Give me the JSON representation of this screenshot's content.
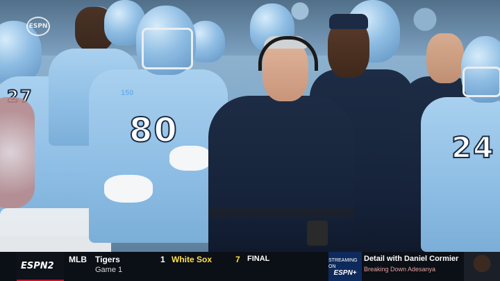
{
  "broadcast": {
    "corner_bug": "ESPN",
    "network_logo": "ESPN2"
  },
  "scene": {
    "player_left_number": "80",
    "player_right_number": "24",
    "player_partial_number": "27",
    "patch_text": "150",
    "colors": {
      "carolina_blue": "#8dbde4",
      "navy": "#15223a"
    }
  },
  "ticker": {
    "league": "MLB",
    "away_team": "Tigers",
    "game_label": "Game 1",
    "away_score": "1",
    "home_team": "White Sox",
    "home_score": "7",
    "status": "FINAL",
    "stream_label_top": "STREAMING ON",
    "stream_label_brand": "ESPN+",
    "promo_title": "Detail with Daniel Cormier",
    "promo_subtitle": "Breaking Down Adesanya"
  }
}
